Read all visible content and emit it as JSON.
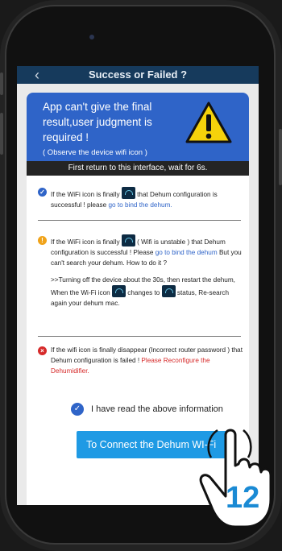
{
  "header": {
    "title": "Success or Failed ?",
    "back_icon": "chevron-left-icon"
  },
  "banner": {
    "message": "App can't give the final result,user judgment is required !",
    "note": "( Observe the device wifi icon )",
    "wait": "First return to this interface, wait for 6s."
  },
  "success": {
    "text_before": "If the WiFi icon is finally",
    "text_after": "that Dehum configuration is successful ! please",
    "link": "go to bind the dehum."
  },
  "unstable": {
    "text_before": "If the WiFi icon is finally",
    "text_after": "( Wifi is unstable ) that Dehum configuration is successful ! Please",
    "link": "go to bind the dehum",
    "text_tail": "But you can't search your dehum. How to do it ?",
    "tip_1": ">>Turning off the device about the 30s, then restart the dehum, When the Wi-Fi icon",
    "tip_2": "changes to",
    "tip_3": "status, Re-search again your dehum mac."
  },
  "failed": {
    "text": "If the wifi icon is finally disappear (Incorrect router password ) that Dehum configuration is failed !",
    "link": "Please Reconfigure the Dehumidifier."
  },
  "confirm": {
    "label": "I have read the above information",
    "checked": true
  },
  "connect_button": {
    "label": "To Connect the Dehum WI-Fi"
  },
  "step_number": "12",
  "colors": {
    "nav": "#163a5c",
    "banner": "#2f64c8",
    "button": "#1f9ae4",
    "error": "#d62a2a",
    "warn": "#f0a31a"
  }
}
